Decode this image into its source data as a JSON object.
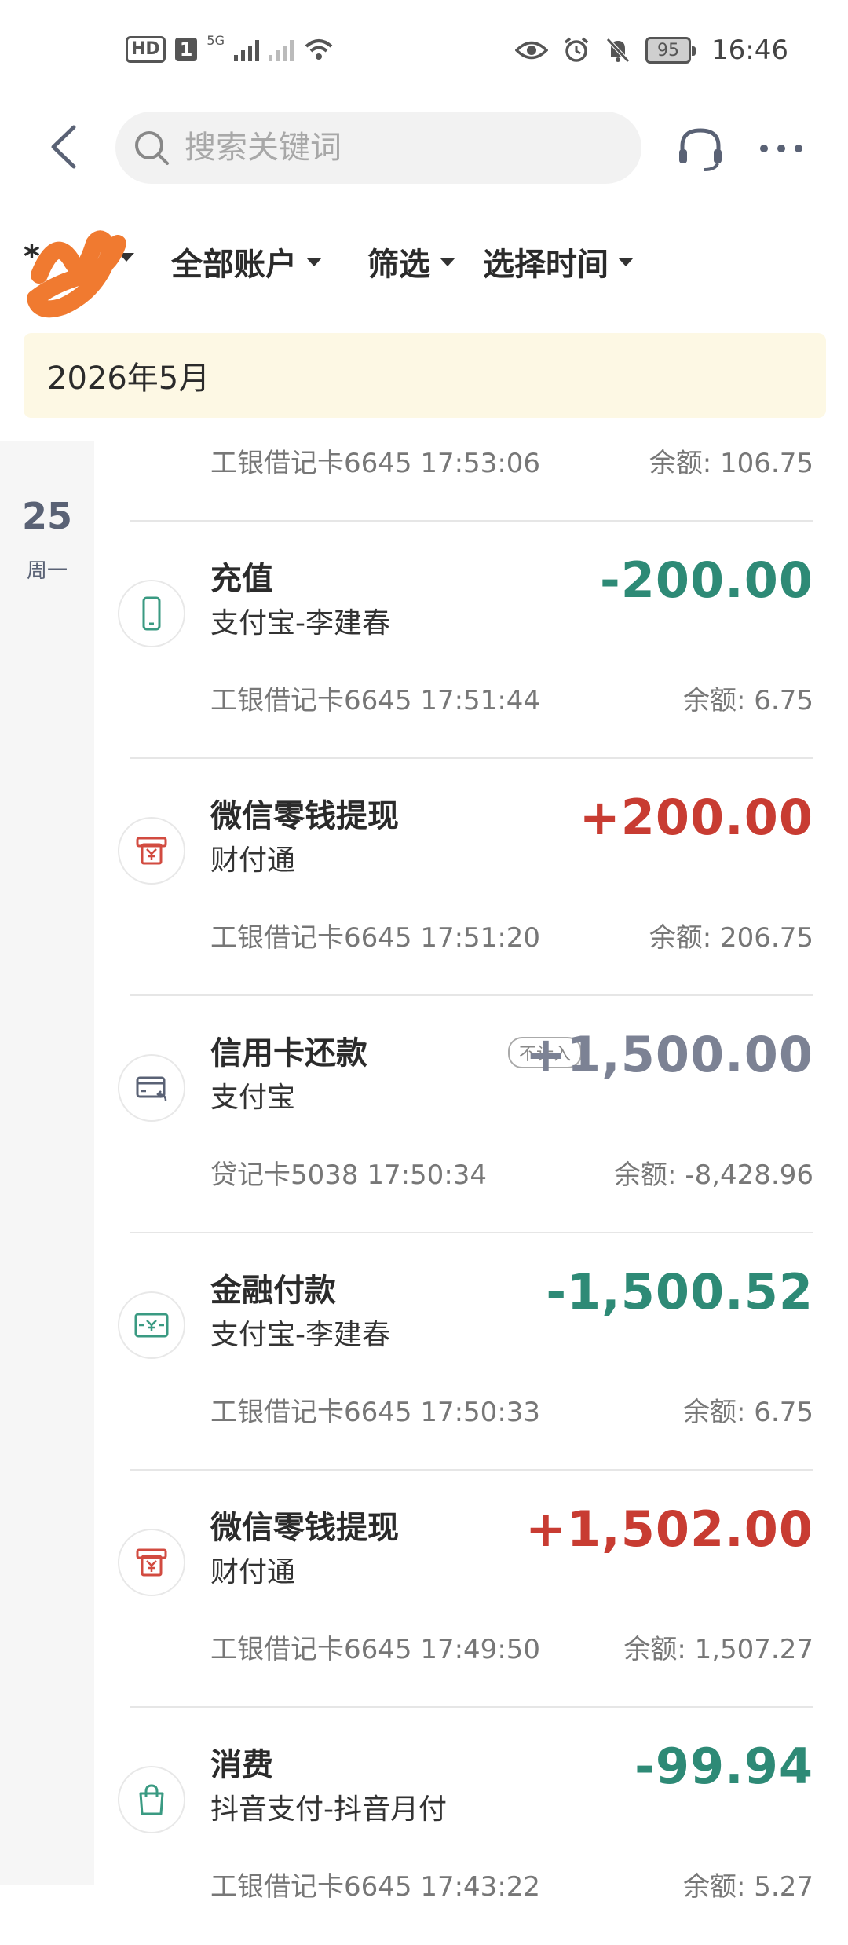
{
  "status_bar": {
    "hd_label": "HD",
    "sim_label": "1",
    "network_label": "5G",
    "battery_level": "95",
    "time": "16:46"
  },
  "search": {
    "placeholder": "搜索关键词",
    "value": ""
  },
  "filters": {
    "account_short": "*",
    "all_accounts": "全部账户",
    "filter": "筛选",
    "select_time": "选择时间"
  },
  "month_banner": "2026年5月",
  "day": {
    "number": "25",
    "weekday": "周一"
  },
  "partial_top": {
    "meta": "工银借记卡6645  17:53:06",
    "balance": "余额: 106.75"
  },
  "transactions": [
    {
      "title": "充值",
      "subtitle": "支付宝-李建春",
      "amount": "-200.00",
      "type": "neg",
      "meta": "工银借记卡6645  17:51:44",
      "balance": "余额: 6.75",
      "icon": "phone-icon",
      "tag": ""
    },
    {
      "title": "微信零钱提现",
      "subtitle": "财付通",
      "amount": "+200.00",
      "type": "pos",
      "meta": "工银借记卡6645  17:51:20",
      "balance": "余额: 206.75",
      "icon": "withdraw-icon",
      "tag": ""
    },
    {
      "title": "信用卡还款",
      "subtitle": "支付宝",
      "amount": "+1,500.00",
      "type": "gray",
      "meta": "贷记卡5038  17:50:34",
      "balance": "余额: -8,428.96",
      "icon": "credit-card-icon",
      "tag": "不计入"
    },
    {
      "title": "金融付款",
      "subtitle": "支付宝-李建春",
      "amount": "-1,500.52",
      "type": "neg",
      "meta": "工银借记卡6645  17:50:33",
      "balance": "余额: 6.75",
      "icon": "money-transfer-icon",
      "tag": ""
    },
    {
      "title": "微信零钱提现",
      "subtitle": "财付通",
      "amount": "+1,502.00",
      "type": "pos",
      "meta": "工银借记卡6645  17:49:50",
      "balance": "余额: 1,507.27",
      "icon": "withdraw-icon",
      "tag": ""
    },
    {
      "title": "消费",
      "subtitle": "抖音支付-抖音月付",
      "amount": "-99.94",
      "type": "neg",
      "meta": "工银借记卡6645  17:43:22",
      "balance": "余额: 5.27",
      "icon": "shopping-bag-icon",
      "tag": ""
    }
  ],
  "colors": {
    "negative": "#2e8a76",
    "positive": "#c83c32",
    "excluded": "#7c8294",
    "banner": "#fdf8e4"
  }
}
